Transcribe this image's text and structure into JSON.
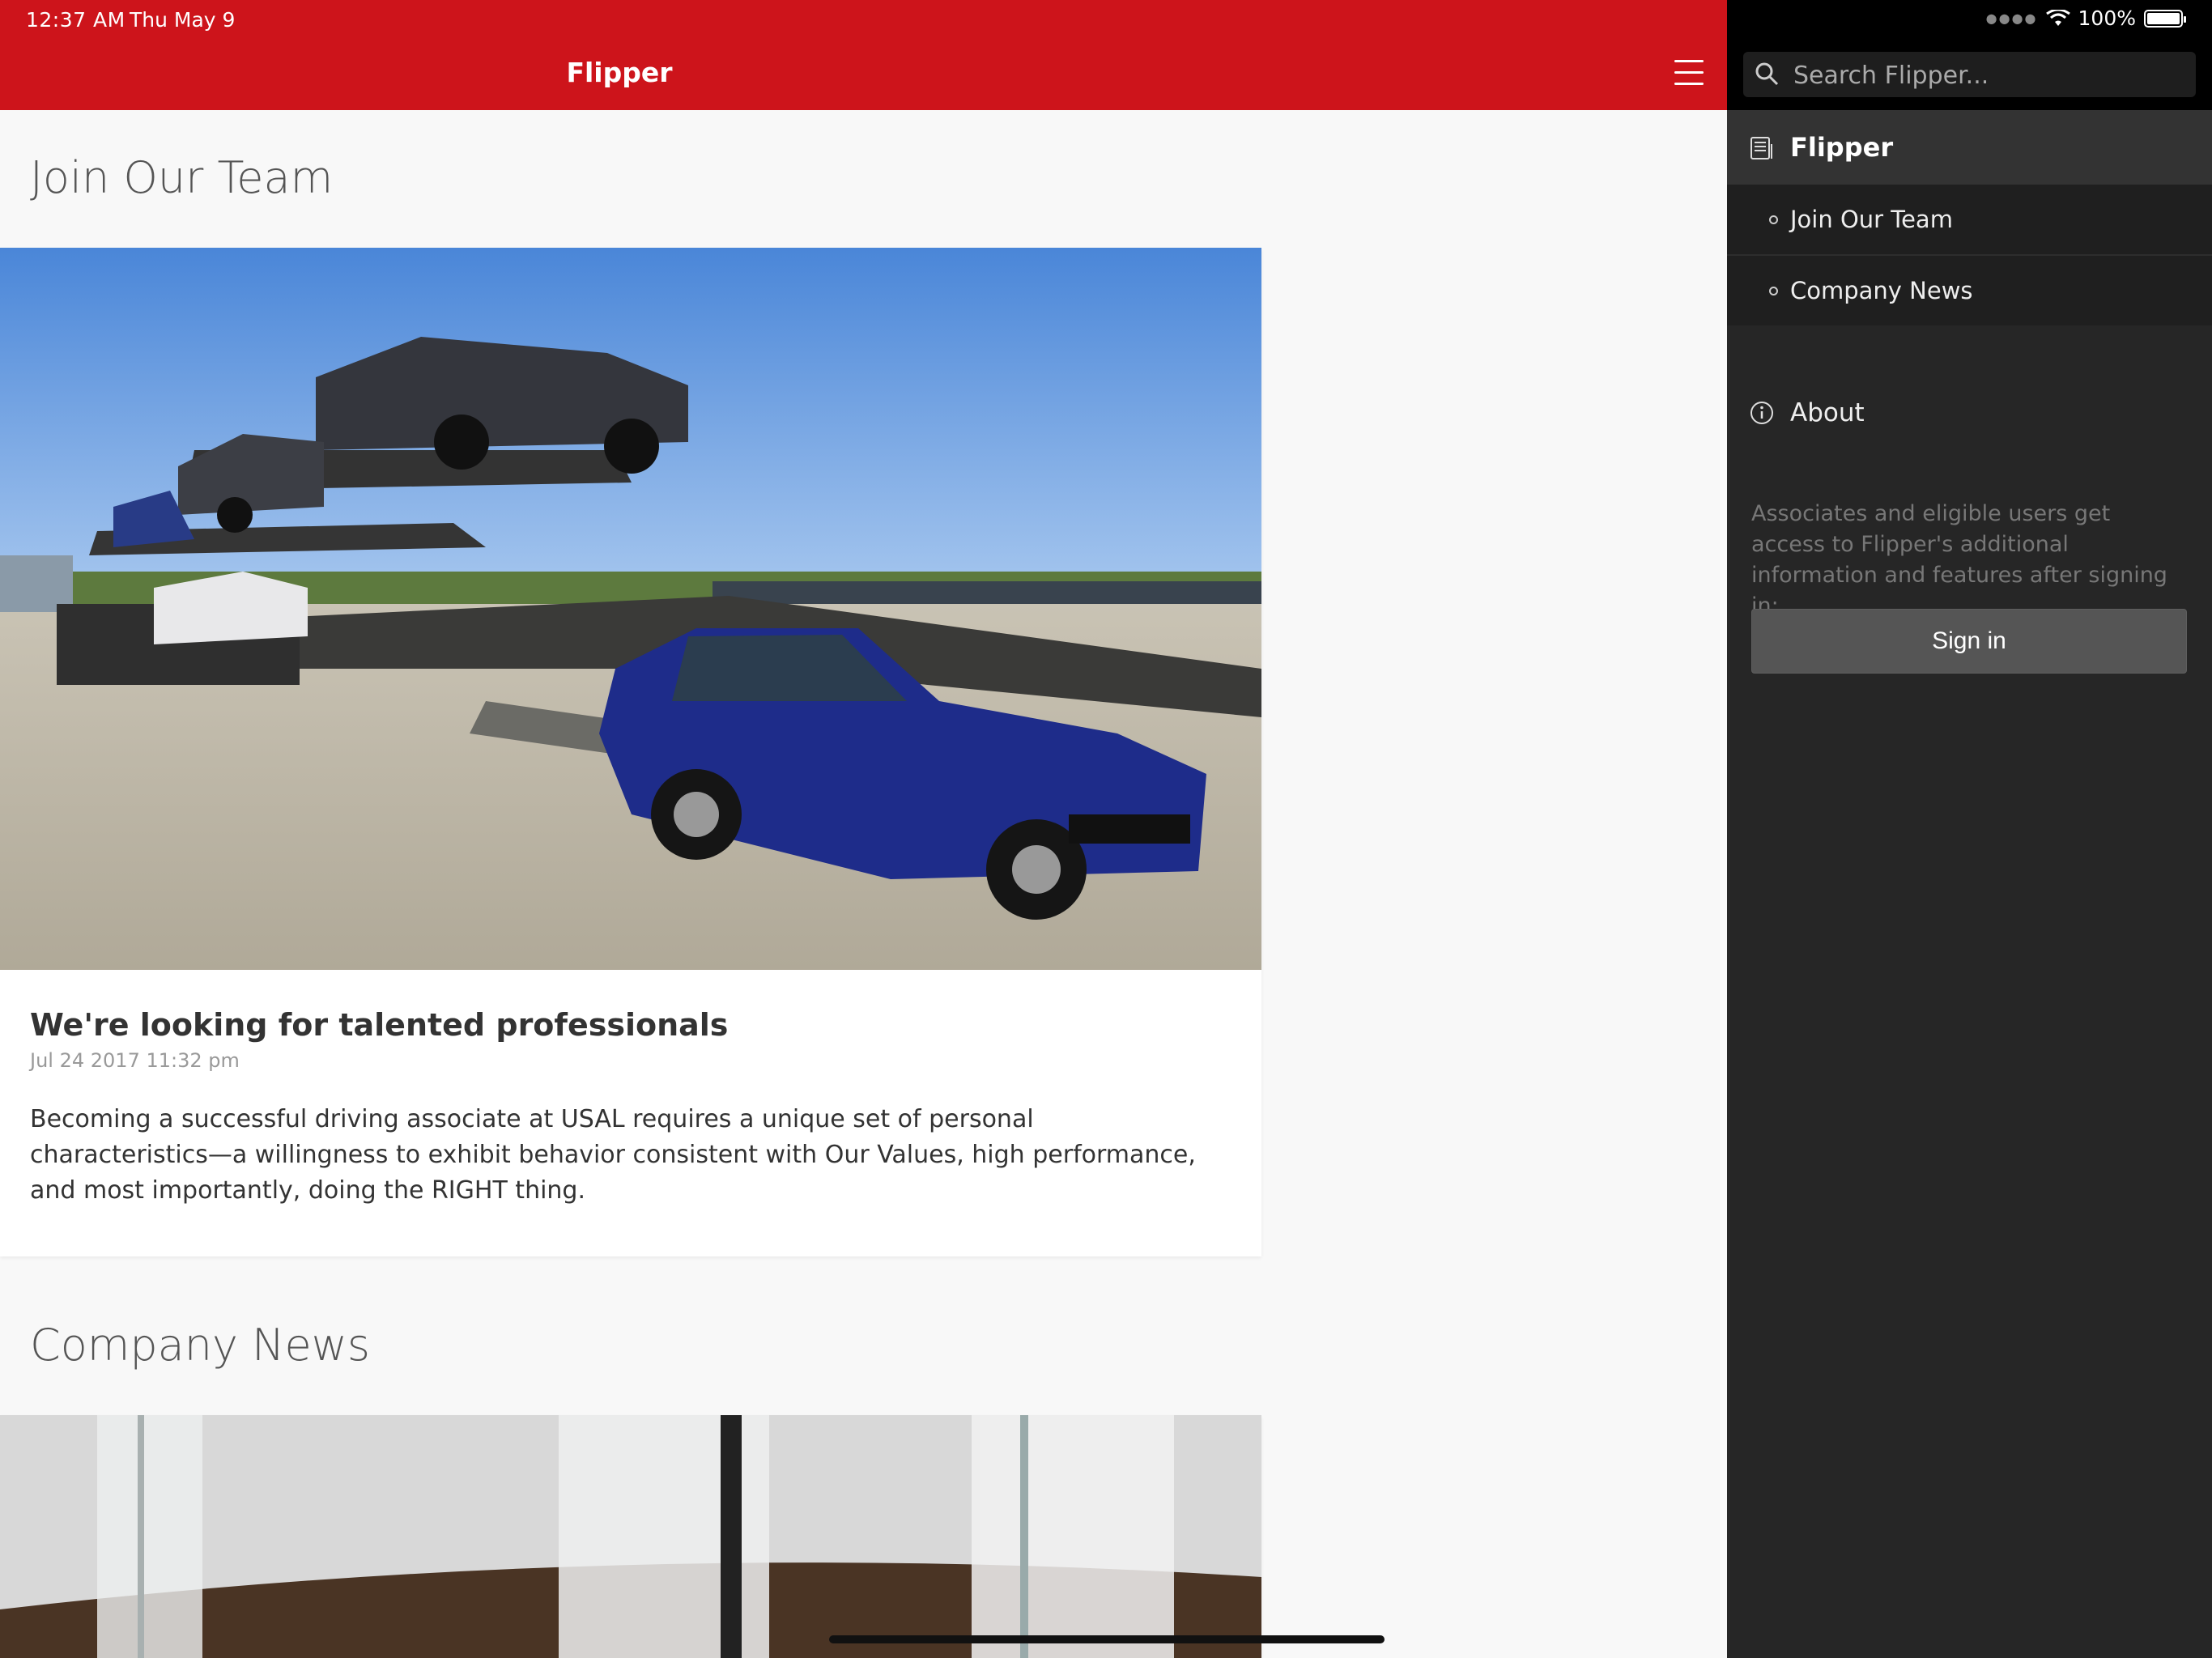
{
  "status_bar": {
    "time": "12:37 AM",
    "date": "Thu May 9",
    "battery": "100%"
  },
  "header": {
    "title": "Flipper",
    "menu_icon": "hamburger-icon"
  },
  "sections": [
    {
      "title": "Join Our Team",
      "card": {
        "title": "We're looking for talented professionals",
        "date": "Jul 24 2017 11:32 pm",
        "body": "Becoming a successful driving associate at USAL requires a unique set of personal characteristics—a willingness to exhibit behavior consistent with Our Values, high performance, and most importantly, doing the RIGHT thing."
      }
    },
    {
      "title": "Company News"
    }
  ],
  "sidebar": {
    "search_placeholder": "Search Flipper...",
    "nav_head": {
      "label": "Flipper",
      "icon": "newspaper-icon"
    },
    "items": [
      {
        "label": "Join Our Team"
      },
      {
        "label": "Company News"
      }
    ],
    "about": {
      "label": "About",
      "icon": "info-icon"
    },
    "info_text": "Associates and eligible users get access to Flipper's additional information and features after signing in:",
    "signin_label": "Sign in"
  },
  "colors": {
    "accent": "#cd141b",
    "sidebar_bg": "#262626"
  }
}
